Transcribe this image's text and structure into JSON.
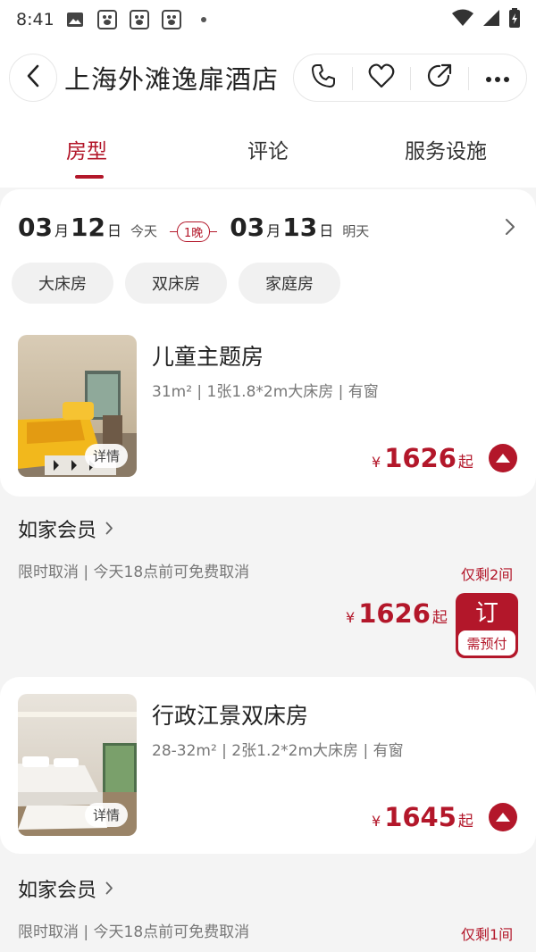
{
  "status_bar": {
    "time": "8:41"
  },
  "header": {
    "title": "上海外滩逸扉酒店",
    "actions": [
      "phone-icon",
      "heart-icon",
      "share-icon",
      "more-icon"
    ]
  },
  "tabs": [
    {
      "label": "房型",
      "active": true
    },
    {
      "label": "评论",
      "active": false
    },
    {
      "label": "服务设施",
      "active": false
    }
  ],
  "dates": {
    "checkin_month": "03",
    "checkin_day": "12",
    "checkin_label": "今天",
    "nights": "1晚",
    "checkout_month": "03",
    "checkout_day": "13",
    "checkout_label": "明天",
    "month_unit": "月",
    "day_unit": "日"
  },
  "filters": [
    "大床房",
    "双床房",
    "家庭房"
  ],
  "rooms": [
    {
      "name": "儿童主题房",
      "spec": "31m² | 1张1.8*2m大床房 | 有窗",
      "detail_label": "详情",
      "currency": "¥",
      "price": "1626",
      "price_suffix": "起",
      "plan": {
        "title": "如家会员",
        "cancel": "限时取消 | 今天18点前可免费取消",
        "stock": "仅剩2间",
        "price": "1626",
        "book_label": "订",
        "book_sub": "需预付"
      }
    },
    {
      "name": "行政江景双床房",
      "spec": "28-32m² | 2张1.2*2m大床房 | 有窗",
      "detail_label": "详情",
      "currency": "¥",
      "price": "1645",
      "price_suffix": "起",
      "plan": {
        "title": "如家会员",
        "cancel": "限时取消 | 今天18点前可免费取消",
        "stock": "仅剩1间"
      }
    }
  ],
  "colors": {
    "accent": "#b3172a",
    "page_bg": "#f4f4f4"
  }
}
